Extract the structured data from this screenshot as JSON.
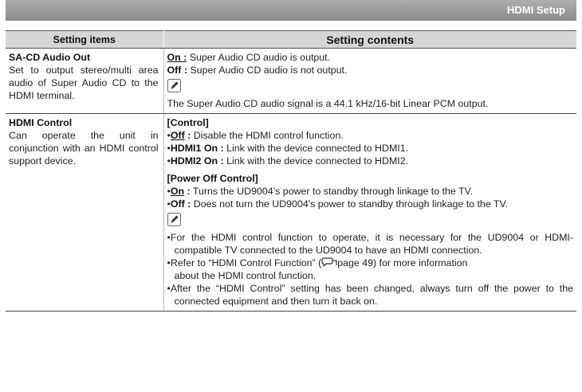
{
  "header": {
    "title": "HDMI Setup"
  },
  "table": {
    "col_items": "Setting items",
    "col_contents": "Setting contents",
    "rows": [
      {
        "title": "SA-CD Audio Out",
        "desc": "Set to output stereo/multi area audio of Super Audio CD to the HDMI terminal.",
        "opt1_label": "On :",
        "opt1_text": "Super Audio CD audio is output.",
        "opt2_label": "Off :",
        "opt2_text": "Super Audio CD audio is not output.",
        "note": "The Super Audio CD audio signal is a 44.1 kHz/16-bit Linear PCM output."
      },
      {
        "title": "HDMI Control",
        "desc": "Can operate the unit in conjunction with an HDMI control support device.",
        "control_head": "[Control]",
        "control_opts": [
          {
            "label": "Off",
            "sep": " :",
            "text": "Disable the HDMI control function."
          },
          {
            "label": "HDMI1 On :",
            "text": "Link with the device connected to HDMI1."
          },
          {
            "label": "HDMI2 On :",
            "text": "Link with the device connected to HDMI2."
          }
        ],
        "poweroff_head": "[Power Off Control]",
        "poweroff_opts": [
          {
            "label": "On",
            "sep": " :",
            "text": "Turns the UD9004’s power to standby through linkage to the TV."
          },
          {
            "label": "Off :",
            "text": "Does not turn the UD9004's power to standby through linkage to the TV."
          }
        ],
        "notes": [
          "For the HDMI control function to operate, it is necessary for the UD9004 or HDMI-compatible TV connected to the UD9004  to have an HDMI connection.",
          "about the HDMI control function.",
          "After the “HDMI Control” setting has been changed, always turn off the power to the connected equipment and then turn it back on."
        ],
        "ref_before": "Refer to “HDMI Control Function” (",
        "ref_after": "page 49) for more information"
      }
    ]
  }
}
